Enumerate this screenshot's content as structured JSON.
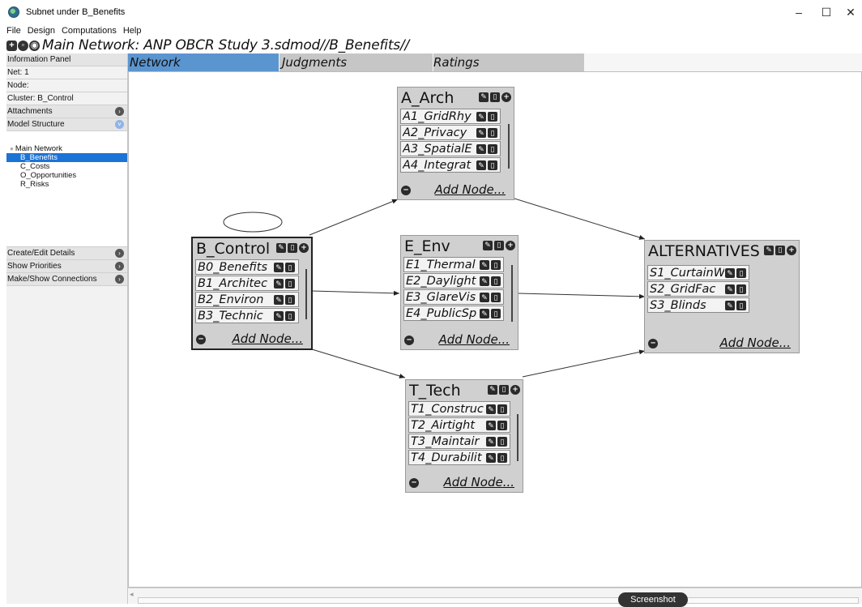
{
  "window": {
    "title": "Subnet under B_Benefits",
    "controls": [
      "–",
      "☐",
      "✕"
    ]
  },
  "menu": [
    "File",
    "Design",
    "Computations",
    "Help"
  ],
  "breadcrumb": "Main Network: ANP OBCR Study 3.sdmod//B_Benefits//",
  "left_panel": {
    "information_panel": "Information Panel",
    "net": "Net: 1",
    "node": "Node:",
    "cluster": "Cluster: B_Control",
    "attachments": "Attachments",
    "model_structure": "Model Structure",
    "tree": {
      "root": "Main Network",
      "children": [
        "B_Benefits",
        "C_Costs",
        "O_Opportunities",
        "R_Risks"
      ]
    },
    "create_edit": "Create/Edit Details",
    "show_priorities": "Show Priorities",
    "make_show": "Make/Show Connections"
  },
  "tabs": [
    "Network",
    "Judgments",
    "Ratings"
  ],
  "add_node_label": "Add Node...",
  "clusters": {
    "arch": {
      "title": "A_Arch",
      "nodes": [
        "A1_GridRhy",
        "A2_Privacy",
        "A3_SpatialE",
        "A4_Integrat"
      ]
    },
    "control": {
      "title": "B_Control",
      "nodes": [
        "B0_Benefits",
        "B1_Architec",
        "B2_Environ",
        "B3_Technic"
      ]
    },
    "env": {
      "title": "E_Env",
      "nodes": [
        "E1_Thermal",
        "E2_Daylight",
        "E3_GlareVis",
        "E4_PublicSp"
      ]
    },
    "alt": {
      "title": "ALTERNATIVES",
      "nodes": [
        "S1_CurtainW",
        "S2_GridFac",
        "S3_Blinds"
      ]
    },
    "tech": {
      "title": "T_Tech",
      "nodes": [
        "T1_Construc",
        "T2_Airtight",
        "T3_Maintair",
        "T4_Durabilit"
      ]
    }
  },
  "overlay": "Screenshot"
}
